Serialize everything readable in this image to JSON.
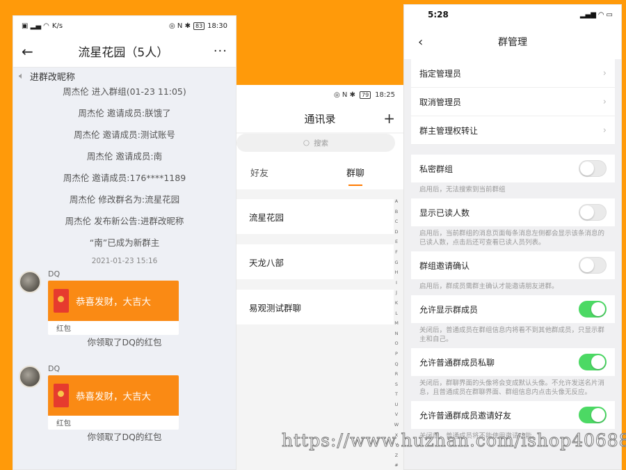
{
  "chat": {
    "status": {
      "net": "K/s",
      "battery": "83",
      "time": "18:30"
    },
    "title": "流星花园（5人）",
    "notice": "进群改昵称",
    "system_messages": [
      "周杰伦 进入群组(01-23 11:05)",
      "周杰伦 邀请成员:朕饿了",
      "周杰伦 邀请成员:测试账号",
      "周杰伦 邀请成员:南",
      "周杰伦 邀请成员:176****1189",
      "周杰伦 修改群名为:流星花园",
      "周杰伦 发布新公告:进群改昵称",
      "“南”已成为新群主"
    ],
    "timestamp": "2021-01-23 15:16",
    "messages": [
      {
        "nick": "DQ",
        "packet_text": "恭喜发财，大吉大",
        "packet_label": "红包",
        "received": "你领取了DQ的红包"
      },
      {
        "nick": "DQ",
        "packet_text": "恭喜发财，大吉大",
        "packet_label": "红包",
        "received": "你领取了DQ的红包"
      }
    ]
  },
  "contacts": {
    "status": {
      "battery": "79",
      "time": "18:25"
    },
    "title": "通讯录",
    "search_placeholder": "搜索",
    "tabs": [
      "好友",
      "群聊"
    ],
    "groups": [
      "流星花园",
      "天龙八部",
      "易观测试群聊"
    ],
    "index": [
      "A",
      "B",
      "C",
      "D",
      "E",
      "F",
      "G",
      "H",
      "I",
      "J",
      "K",
      "L",
      "M",
      "N",
      "O",
      "P",
      "Q",
      "R",
      "S",
      "T",
      "U",
      "V",
      "W",
      "X",
      "Y",
      "Z",
      "#"
    ]
  },
  "manage": {
    "status": {
      "time": "5:28"
    },
    "title": "群管理",
    "links": [
      "指定管理员",
      "取消管理员",
      "群主管理权转让"
    ],
    "toggles": [
      {
        "label": "私密群组",
        "on": false,
        "hint": "启用后，无法搜索到当前群组"
      },
      {
        "label": "显示已读人数",
        "on": false,
        "hint": "启用后，当前群组的消息页面每条消息左侧都会显示该条消息的已读人数，点击后还可查看已读人员列表。"
      },
      {
        "label": "群组邀请确认",
        "on": false,
        "hint": "启用后，群成员需群主确认才能邀请朋友进群。"
      },
      {
        "label": "允许显示群成员",
        "on": true,
        "hint": "关闭后，普通成员在群组信息内将看不到其他群成员，只显示群主和自己。"
      },
      {
        "label": "允许普通群成员私聊",
        "on": true,
        "hint": "关闭后，群聊界面的头像将会变成默认头像。不允许发送名片消息，且普通成员在群聊界面、群组信息内点击头像无反应。"
      },
      {
        "label": "允许普通群成员邀请好友",
        "on": true,
        "hint": "关闭后，普通成员将不能使用邀请功能。"
      }
    ]
  },
  "watermark": "https://www.huzhan.com/ishop40688"
}
